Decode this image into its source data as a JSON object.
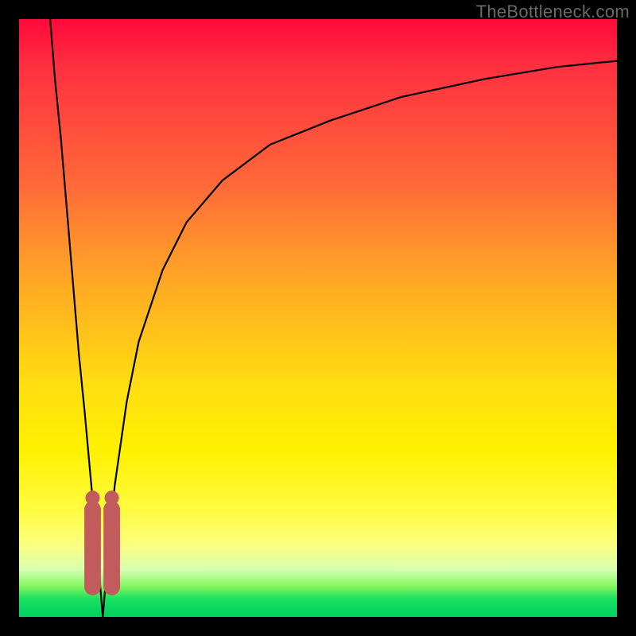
{
  "watermark": "TheBottleneck.com",
  "chart_data": {
    "type": "line",
    "title": "",
    "xlabel": "",
    "ylabel": "",
    "xlim": [
      0,
      100
    ],
    "ylim": [
      0,
      100
    ],
    "grid": false,
    "legend": false,
    "curve_minimum_x": 14,
    "background_gradient_stops": [
      {
        "pct": 0,
        "color": "#ff0a3a"
      },
      {
        "pct": 28,
        "color": "#ff6a38"
      },
      {
        "pct": 52,
        "color": "#ffc21a"
      },
      {
        "pct": 72,
        "color": "#fff000"
      },
      {
        "pct": 92,
        "color": "#d8ffb0"
      },
      {
        "pct": 100,
        "color": "#00d060"
      }
    ],
    "series": [
      {
        "name": "left-branch",
        "x": [
          5.2,
          6,
          7,
          8,
          9,
          10,
          11,
          12,
          13,
          14
        ],
        "values": [
          100,
          90,
          80,
          68,
          56,
          44,
          34,
          23,
          12,
          0
        ]
      },
      {
        "name": "right-branch",
        "x": [
          14,
          15,
          16,
          18,
          20,
          24,
          28,
          34,
          42,
          52,
          64,
          78,
          90,
          100
        ],
        "values": [
          0,
          12,
          22,
          36,
          46,
          58,
          66,
          73,
          79,
          83,
          87,
          90,
          92,
          93
        ]
      }
    ],
    "markers": [
      {
        "name": "left-pill",
        "cx": 12.3,
        "cy_top": 82,
        "cy_bottom": 95,
        "r": 1.2,
        "color": "#c25b5b"
      },
      {
        "name": "right-pill",
        "cx": 15.5,
        "cy_top": 82,
        "cy_bottom": 95,
        "r": 1.2,
        "color": "#c25b5b"
      }
    ]
  }
}
